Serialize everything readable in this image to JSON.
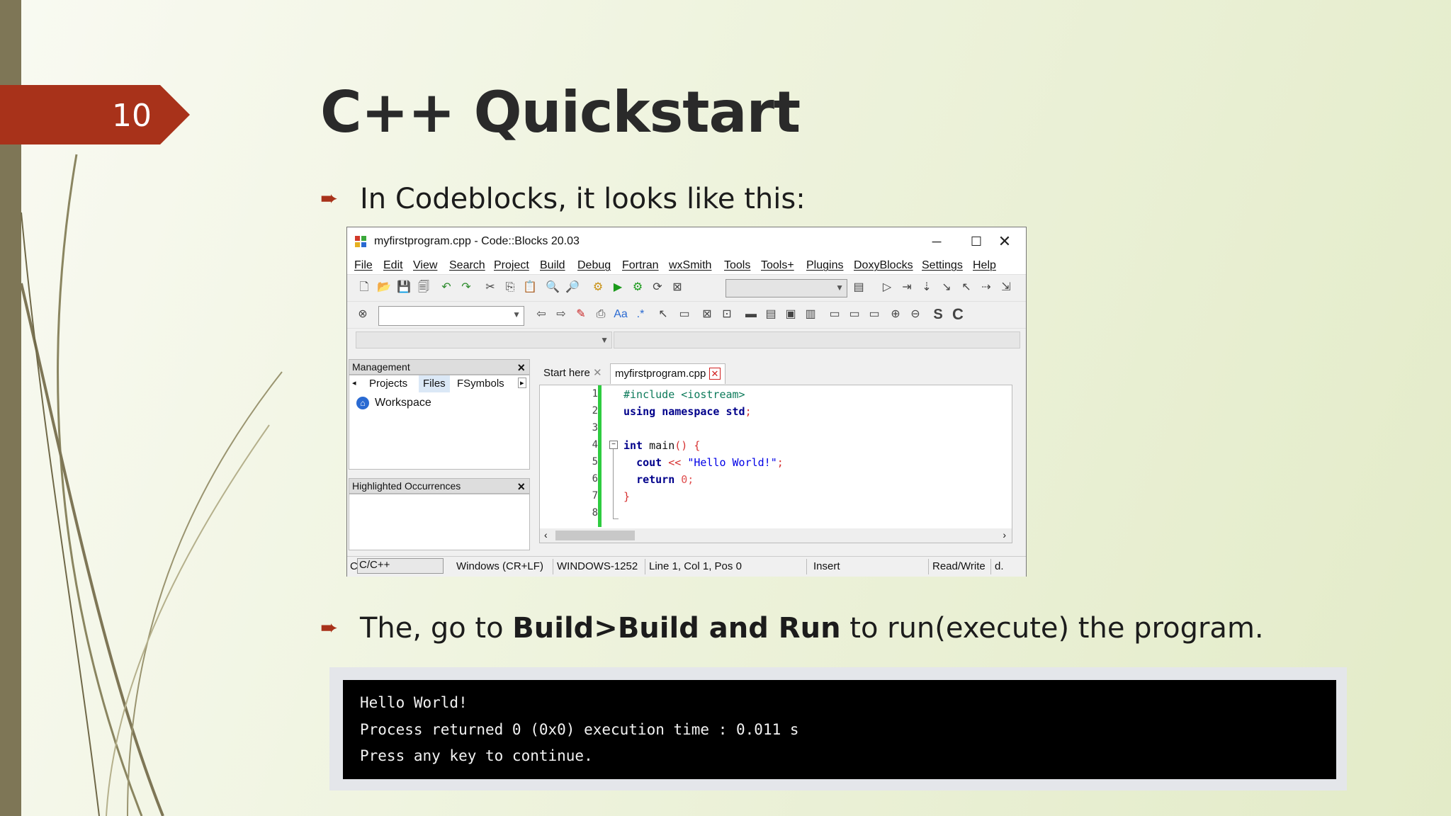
{
  "slide": {
    "number": "10",
    "title": "C++ Quickstart",
    "bullet1": "In Codeblocks, it looks like this:",
    "bullet2_pre": "The, go to ",
    "bullet2_bold": "Build>Build and Run",
    "bullet2_post": " to run(execute) the program.",
    "colors": {
      "accent": "#a8321a",
      "left_bar": "#7e7656"
    }
  },
  "window": {
    "title": "myfirstprogram.cpp - Code::Blocks 20.03",
    "menu": [
      "File",
      "Edit",
      "View",
      "Search",
      "Project",
      "Build",
      "Debug",
      "Fortran",
      "wxSmith",
      "Tools",
      "Tools+",
      "Plugins",
      "DoxyBlocks",
      "Settings",
      "Help"
    ],
    "management": {
      "header": "Management",
      "tabs": [
        "Projects",
        "Files",
        "FSymbols"
      ],
      "workspace": "Workspace"
    },
    "highlighted": {
      "header": "Highlighted Occurrences"
    },
    "editor_tabs": [
      "Start here",
      "myfirstprogram.cpp"
    ],
    "line_numbers": [
      "1",
      "2",
      "3",
      "4",
      "5",
      "6",
      "7",
      "8"
    ],
    "code": {
      "l1": "#include <iostream>",
      "l2_kw1": "using",
      "l2_kw2": "namespace",
      "l2_id": "std",
      "l2_end": ";",
      "l4_kw": "int",
      "l4_rest": " main",
      "l4_paren": "() {",
      "l5_id": "cout",
      "l5_op": " << ",
      "l5_str": "\"Hello World!\"",
      "l5_end": ";",
      "l6_kw": "return",
      "l6_num": " 0;",
      "l7": "}"
    },
    "status": {
      "lang": "C/C++",
      "eol": "Windows (CR+LF)",
      "encoding": "WINDOWS-1252",
      "position": "Line 1, Col 1, Pos 0",
      "mode": "Insert",
      "access": "Read/Write",
      "extra": "d."
    }
  },
  "console": {
    "lines": [
      "Hello World!",
      "Process returned 0 (0x0) execution time : 0.011 s",
      "Press any key to continue."
    ]
  }
}
